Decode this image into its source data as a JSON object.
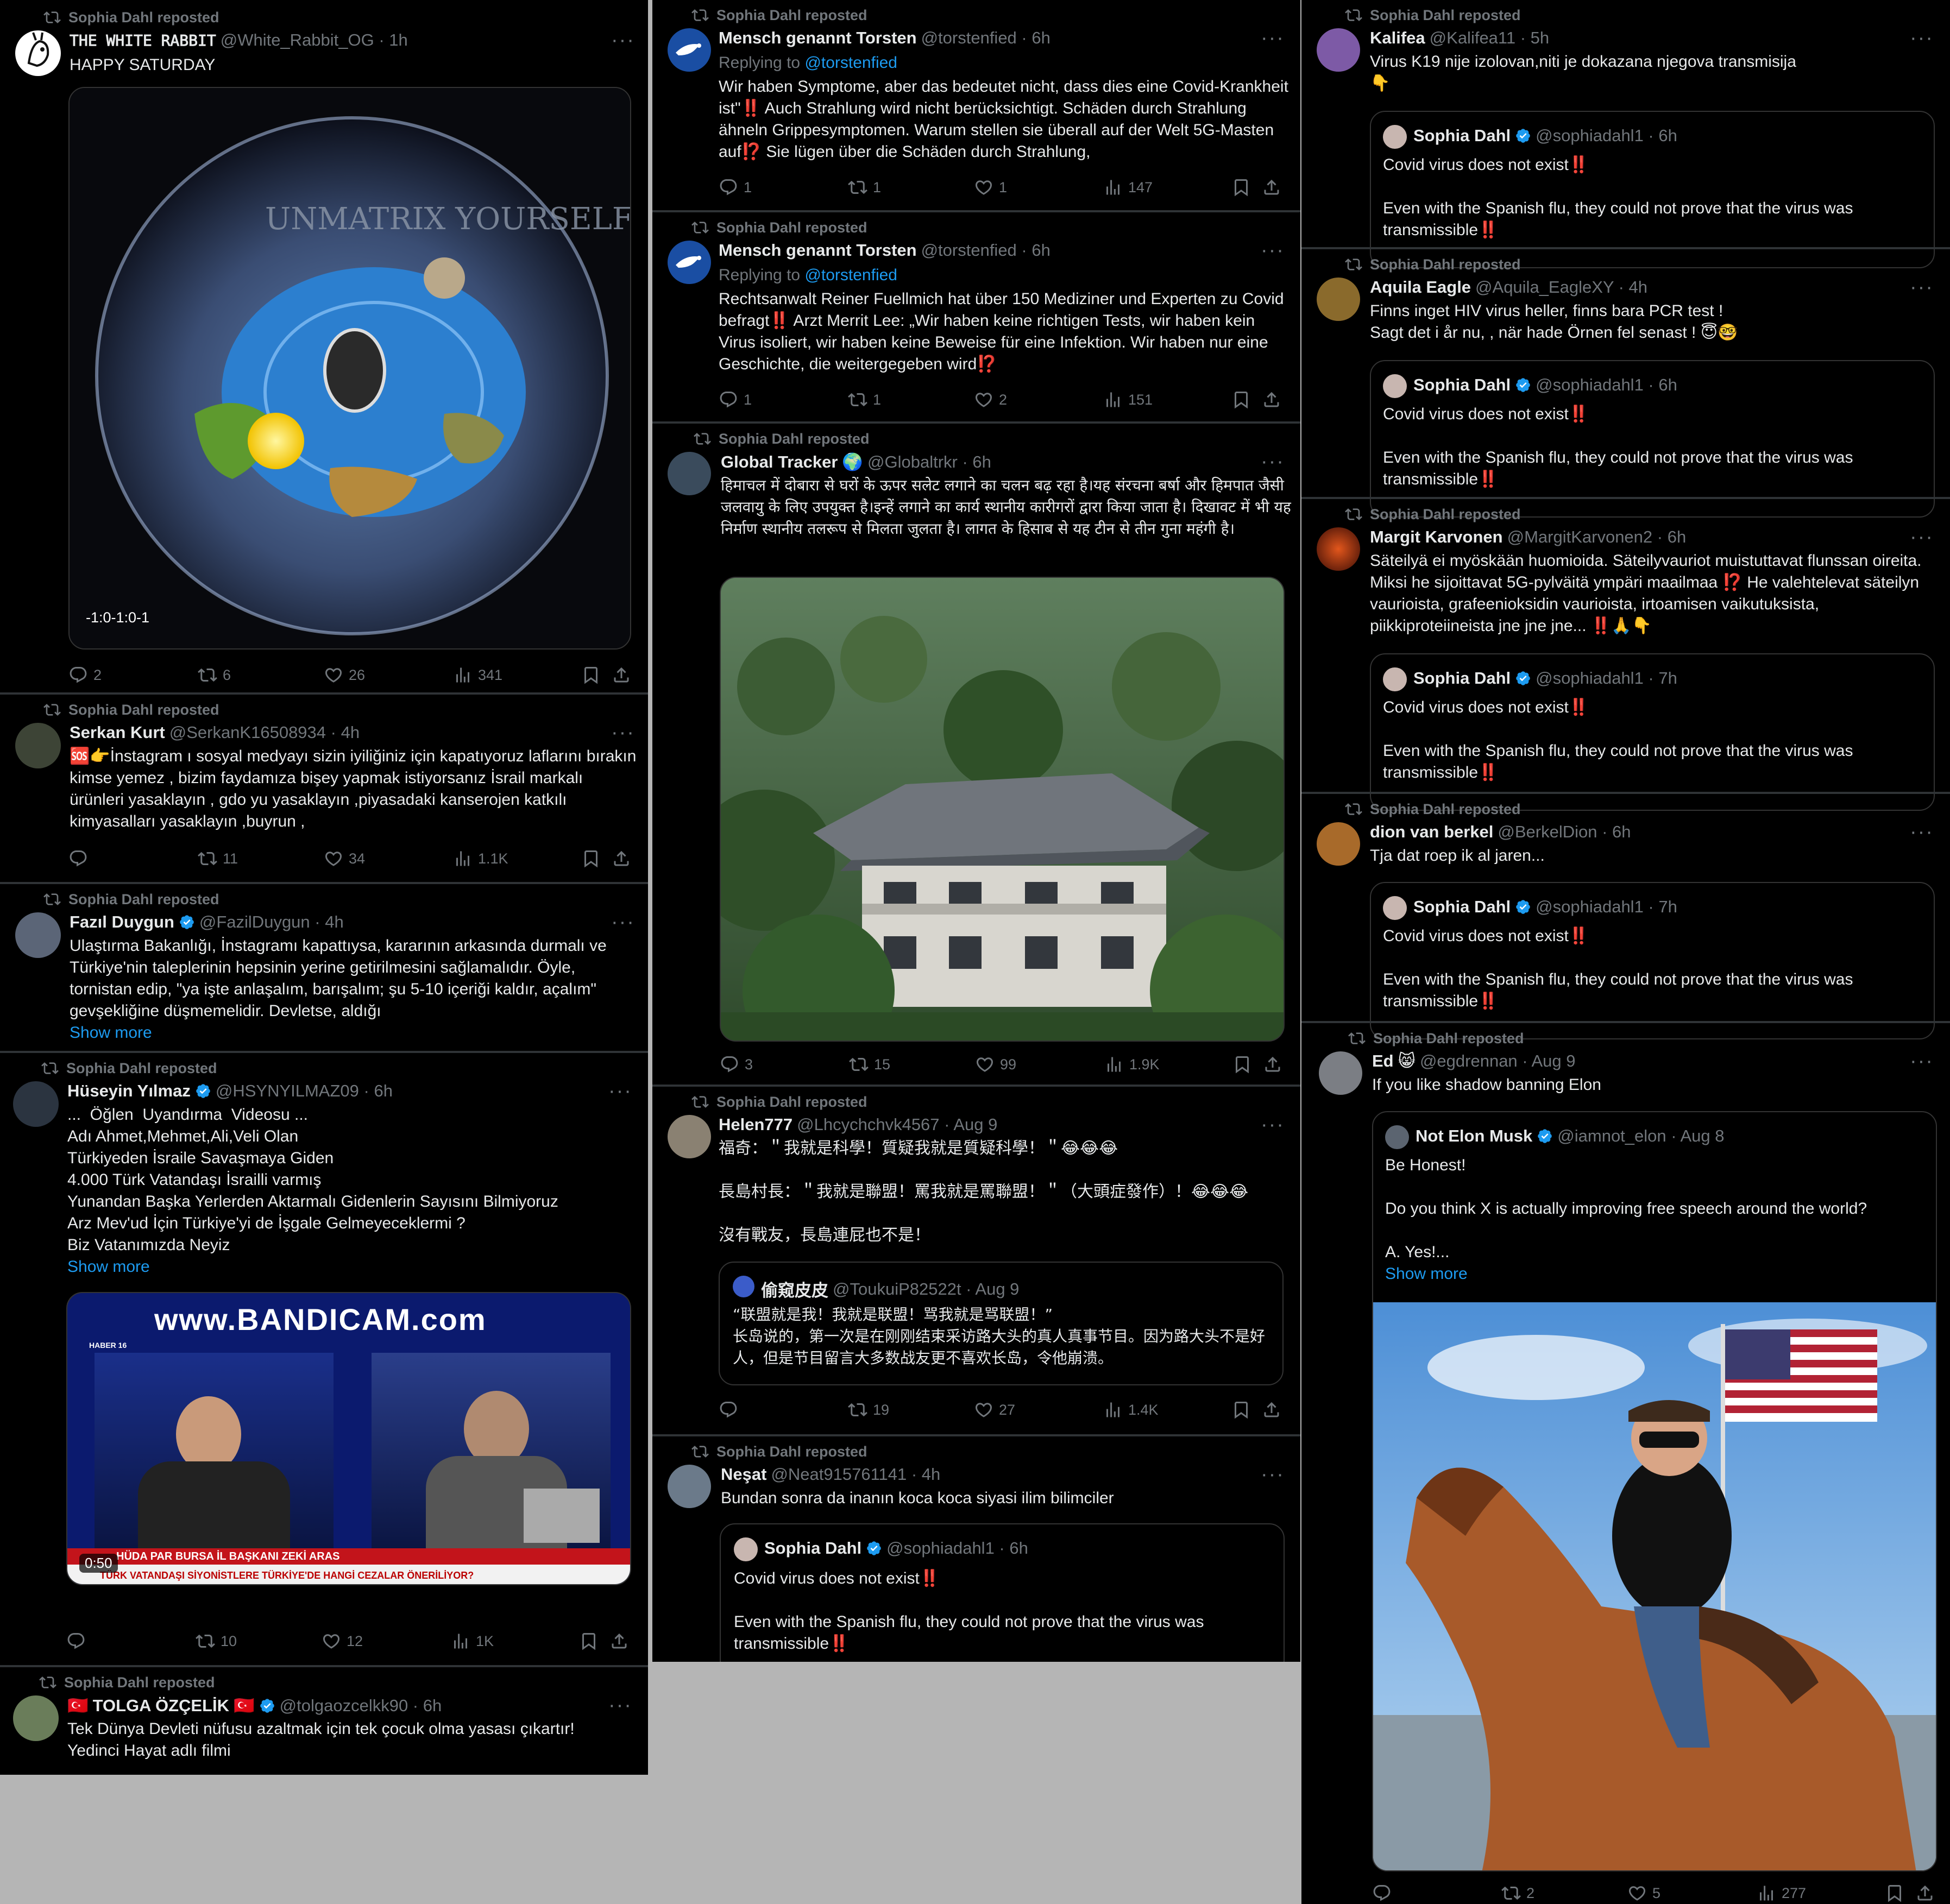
{
  "repost_label": "Sophia Dahl reposted",
  "col1": [
    {
      "name": "𝚃𝙷𝙴 𝚆𝙷𝙸𝚃𝙴 𝚁𝙰𝙱𝙱𝙸𝚃",
      "handle": "@White_Rabbit_OG · 1h",
      "text": "HAPPY SATURDAY",
      "video_time": "-1:0-1:0-1",
      "video_label": "UNMATRIX YOURSELF",
      "replies": "2",
      "reposts": "6",
      "likes": "26",
      "views": "341"
    },
    {
      "name": "Serkan Kurt",
      "handle": "@SerkanK16508934 · 4h",
      "text": "🆘👉İnstagram ı sosyal medyayı sizin iyiliğiniz için kapatıyoruz laflarını bırakın kimse yemez , bizim faydamıza bişey yapmak istiyorsanız İsrail markalı ürünleri yasaklayın , gdo yu yasaklayın ,piyasadaki kanserojen katkılı kimyasalları yasaklayın ,buyrun ,",
      "replies": "",
      "reposts": "11",
      "likes": "34",
      "views": "1.1K"
    },
    {
      "name": "Fazıl Duygun",
      "handle": "@FazilDuygun · 4h",
      "text": "Ulaştırma Bakanlığı, İnstagramı kapattıysa, kararının arkasında durmalı ve Türkiye'nin taleplerinin hepsinin yerine getirilmesini sağlamalıdır. Öyle, tornistan edip, \"ya işte anlaşalım, barışalım; şu 5-10 içeriği kaldır, açalım\" gevşekliğine düşmemelidir. Devletse, aldığı",
      "show_more": "Show more"
    },
    {
      "name": "Hüseyin Yılmaz",
      "handle": "@HSYNYILMAZ09 · 6h",
      "text": "...  Öğlen  Uyandırma  Videosu ...\nAdı Ahmet,Mehmet,Ali,Veli Olan\nTürkiyeden İsraile Savaşmaya Giden\n4.000 Türk Vatandaşı İsrailli varmış\nYunandan Başka Yerlerden Aktarmalı Gidenlerin Sayısını Bilmiyoruz\nArz Mev'ud İçin Türkiye'yi de İşgale Gelmeyeceklermi ?\nBiz Vatanımızda Neyiz",
      "show_more": "Show more",
      "video_banner": "www.BANDICAM.com",
      "ticker1": "HÜDA PAR BURSA İL BAŞKANI ZEKİ ARAS",
      "ticker2": "TÜRK VATANDAŞI SİYONİSTLERE TÜRKİYE'DE HANGİ CEZALAR ÖNERİLİYOR?",
      "channel_logo": "HABER 16",
      "video_time": "0:50",
      "replies": "",
      "reposts": "10",
      "likes": "12",
      "views": "1K"
    },
    {
      "name": "TOLGA ÖZÇELİK",
      "flag1": "🇹🇷",
      "flag2": "🇹🇷",
      "handle": "@tolgaozcelkk90 · 6h",
      "text": "Tek Dünya Devleti nüfusu azaltmak için tek çocuk olma yasası çıkartır!\nYedinci Hayat adlı filmi"
    }
  ],
  "col2": [
    {
      "name": "Mensch genannt Torsten",
      "handle": "@torstenfied · 6h",
      "replying": "Replying to ",
      "replying_handle": "@torstenfied",
      "text": "Wir haben Symptome, aber das bedeutet nicht, dass dies eine Covid-Krankheit ist\"‼️ Auch Strahlung wird nicht berücksichtigt. Schäden durch Strahlung ähneln Grippesymptomen. Warum stellen sie überall auf der Welt 5G-Masten auf⁉️ Sie lügen über die Schäden durch Strahlung,",
      "replies": "1",
      "reposts": "1",
      "likes": "1",
      "views": "147"
    },
    {
      "name": "Mensch genannt Torsten",
      "handle": "@torstenfied · 6h",
      "replying": "Replying to ",
      "replying_handle": "@torstenfied",
      "text": "Rechtsanwalt Reiner Fuellmich hat über 150 Mediziner und Experten zu Covid befragt‼️ Arzt Merrit Lee: „Wir haben keine richtigen Tests, wir haben kein Virus isoliert, wir haben keine Beweise für eine Infektion. Wir haben nur eine Geschichte, die weitergegeben wird⁉️",
      "replies": "1",
      "reposts": "1",
      "likes": "2",
      "views": "151"
    },
    {
      "name": "Global Tracker",
      "globe": "🌍",
      "handle": "@Globaltrkr · 6h",
      "text": "हिमाचल में दोबारा से घरों के ऊपर सलेट लगाने का चलन बढ़ रहा है।यह संरचना बर्षा और हिमपात जैसी जलवायु के लिए उपयुक्त है।इन्हें लगाने का कार्य स्थानीय कारीगरों द्वारा किया जाता है। दिखावट में भी यह निर्माण स्थानीय तलरूप से मिलता जुलता है। लागत के हिसाब से यह टीन से तीन गुना महंगी है।",
      "replies": "3",
      "reposts": "15",
      "likes": "99",
      "views": "1.9K"
    },
    {
      "name": "Helen777",
      "handle": "@Lhcychchvk4567 · Aug 9",
      "text": "福奇：＂我就是科學！質疑我就是質疑科學！＂😂😂😂\n\n長島村長：＂我就是聯盟！罵我就是罵聯盟！＂（大頭症發作）！😂😂😂\n\n沒有戰友，長島連屁也不是！",
      "quote_name": "偷窥皮皮",
      "quote_handle": "@ToukuiP82522t · Aug 9",
      "quote_text": "“联盟就是我！我就是联盟！骂我就是骂联盟！”\n长岛说的，第一次是在刚刚结束采访路大头的真人真事节目。因为路大头不是好人，但是节目留言大多数战友更不喜欢长岛，令他崩溃。",
      "replies": "",
      "reposts": "19",
      "likes": "27",
      "views": "1.4K"
    },
    {
      "name": "Neşat",
      "handle": "@Neat915761141 · 4h",
      "text": "Bundan sonra da inanın koca koca siyasi ilim bilimciler",
      "quote_name": "Sophia Dahl",
      "quote_handle": "@sophiadahl1 · 6h",
      "quote_text": "Covid virus does not exist‼️\n\nEven with the Spanish flu, they could not prove that the virus was transmissible‼️"
    }
  ],
  "col3": [
    {
      "name": "Kalifea",
      "handle": "@Kalifea11 · 5h",
      "text": "Virus K19 nije izolovan,niti je dokazana njegova transmisija\n👇",
      "quote_name": "Sophia Dahl",
      "quote_handle": "@sophiadahl1 · 6h",
      "quote_text": "Covid virus does not exist‼️\n\nEven with the Spanish flu, they could not prove that the virus was transmissible‼️"
    },
    {
      "name": "Aquila Eagle",
      "handle": "@Aquila_EagleXY · 4h",
      "text": "Finns inget HIV virus heller, finns bara PCR test !\nSagt det i år nu, , när hade Örnen fel senast ! 😇🤓",
      "quote_name": "Sophia Dahl",
      "quote_handle": "@sophiadahl1 · 6h",
      "quote_text": "Covid virus does not exist‼️\n\nEven with the Spanish flu, they could not prove that the virus was transmissible‼️"
    },
    {
      "name": "Margit Karvonen",
      "handle": "@MargitKarvonen2 · 6h",
      "text": "Säteilyä ei myöskään huomioida. Säteilyvauriot muistuttavat flunssan oireita. Miksi he sijoittavat 5G-pylväitä ympäri maailmaa ⁉️ He valehtelevat säteilyn vaurioista, grafeenioksidin vaurioista, irtoamisen vaikutuksista, piikkiproteiineista jne jne jne... ‼️🙏👇",
      "quote_name": "Sophia Dahl",
      "quote_handle": "@sophiadahl1 · 7h",
      "quote_text": "Covid virus does not exist‼️\n\nEven with the Spanish flu, they could not prove that the virus was transmissible‼️"
    },
    {
      "name": "dion van berkel",
      "handle": "@BerkelDion · 6h",
      "text": "Tja dat roep ik al jaren...",
      "quote_name": "Sophia Dahl",
      "quote_handle": "@sophiadahl1 · 7h",
      "quote_text": "Covid virus does not exist‼️\n\nEven with the Spanish flu, they could not prove that the virus was transmissible‼️"
    },
    {
      "name": "Ed",
      "cat": "😸",
      "handle": "@egdrennan · Aug 9",
      "text": "If you like shadow banning Elon",
      "quote_name": "Not Elon Musk",
      "quote_handle": "@iamnot_elon · Aug 8",
      "quote_text": "Be Honest!\n\nDo you think X is actually improving free speech around the world?\n\nA. Yes!...",
      "show_more": "Show more",
      "replies": "",
      "reposts": "2",
      "likes": "5",
      "views": "277"
    }
  ],
  "colors": {
    "accent": "#1d9bf0",
    "muted": "#71767b",
    "text": "#e7e9ea",
    "bg": "#000000",
    "divider": "#2f3336",
    "backdrop": "#b5b5b5"
  },
  "icons": [
    "repost-icon",
    "reply-icon",
    "like-icon",
    "views-icon",
    "bookmark-icon",
    "share-icon",
    "verified-badge-icon",
    "more-options-icon"
  ]
}
